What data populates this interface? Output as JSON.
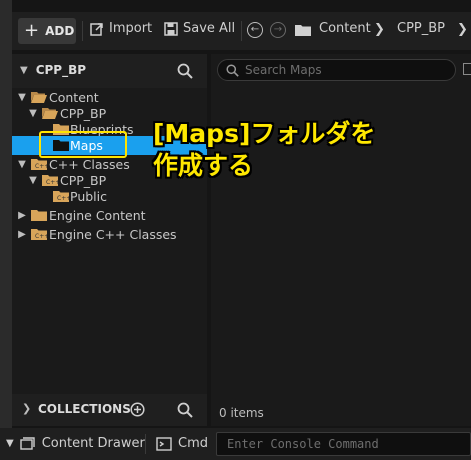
{
  "toolbar": {
    "add_label": "ADD",
    "import_label": "Import",
    "save_all_label": "Save All",
    "breadcrumb": [
      "Content",
      "CPP_BP"
    ]
  },
  "sources": {
    "title": "CPP_BP",
    "tree": [
      {
        "label": "Content"
      },
      {
        "label": "CPP_BP"
      },
      {
        "label": "Blueprints"
      },
      {
        "label": "Maps"
      },
      {
        "label": "C++ Classes"
      },
      {
        "label": "CPP_BP"
      },
      {
        "label": "Public"
      },
      {
        "label": "Engine Content"
      },
      {
        "label": "Engine C++ Classes"
      }
    ],
    "collections_label": "COLLECTIONS"
  },
  "assets": {
    "search_placeholder": "Search Maps",
    "item_count": "0 items"
  },
  "bottombar": {
    "content_drawer_label": "Content Drawer",
    "cmd_label": "Cmd",
    "console_placeholder": "Enter Console Command"
  },
  "annotation": {
    "line1": "[Maps]フォルダを",
    "line2": "作成する"
  },
  "colors": {
    "selection": "#1aa0ee",
    "folder": "#d8a55a",
    "annotation": "#ffe800"
  }
}
